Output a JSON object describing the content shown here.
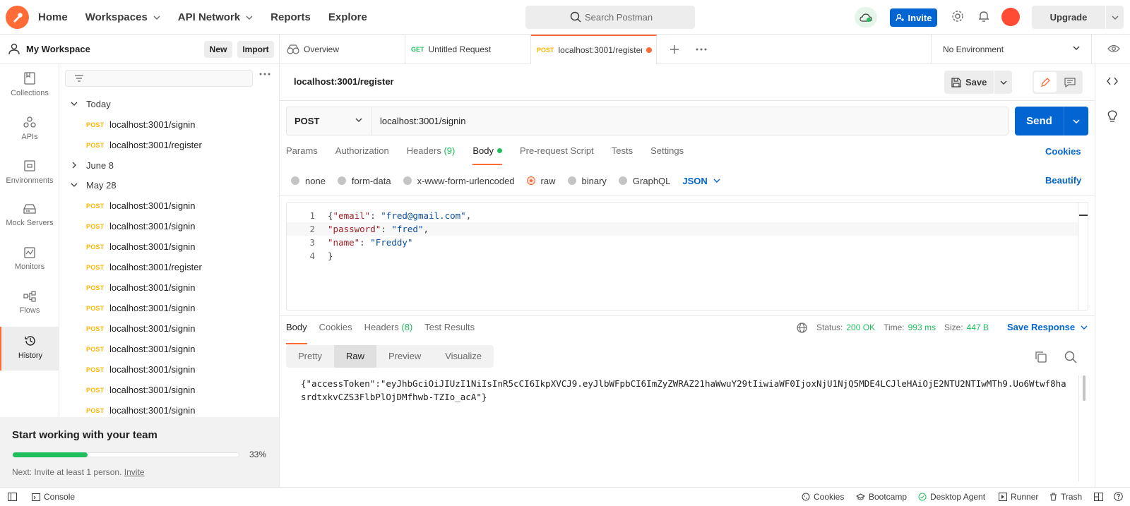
{
  "topbar": {
    "nav": [
      "Home",
      "Workspaces",
      "API Network",
      "Reports",
      "Explore"
    ],
    "search_placeholder": "Search Postman",
    "invite_label": "Invite",
    "upgrade_label": "Upgrade"
  },
  "sidebar": {
    "workspace_title": "My Workspace",
    "new_label": "New",
    "import_label": "Import",
    "rail": [
      {
        "label": "Collections",
        "icon": "collections-icon"
      },
      {
        "label": "APIs",
        "icon": "apis-icon"
      },
      {
        "label": "Environments",
        "icon": "environments-icon"
      },
      {
        "label": "Mock Servers",
        "icon": "mock-servers-icon"
      },
      {
        "label": "Monitors",
        "icon": "monitors-icon"
      },
      {
        "label": "Flows",
        "icon": "flows-icon"
      },
      {
        "label": "History",
        "icon": "history-icon",
        "active": true
      }
    ],
    "history": {
      "groups": [
        {
          "label": "Today",
          "expanded": true
        },
        {
          "label": "June 8",
          "expanded": false
        },
        {
          "label": "May 28",
          "expanded": true
        }
      ],
      "today_items": [
        {
          "method": "POST",
          "url": "localhost:3001/signin"
        },
        {
          "method": "POST",
          "url": "localhost:3001/register"
        }
      ],
      "may28_items": [
        {
          "method": "POST",
          "url": "localhost:3001/signin"
        },
        {
          "method": "POST",
          "url": "localhost:3001/signin"
        },
        {
          "method": "POST",
          "url": "localhost:3001/signin"
        },
        {
          "method": "POST",
          "url": "localhost:3001/register"
        },
        {
          "method": "POST",
          "url": "localhost:3001/signin"
        },
        {
          "method": "POST",
          "url": "localhost:3001/signin"
        },
        {
          "method": "POST",
          "url": "localhost:3001/signin"
        },
        {
          "method": "POST",
          "url": "localhost:3001/signin"
        },
        {
          "method": "POST",
          "url": "localhost:3001/signin"
        },
        {
          "method": "POST",
          "url": "localhost:3001/signin"
        },
        {
          "method": "POST",
          "url": "localhost:3001/signin"
        }
      ]
    },
    "team": {
      "heading": "Start working with your team",
      "progress": 0.33,
      "progress_label": "33%",
      "next_text": "Next: Invite at least 1 person.",
      "next_link": "Invite"
    }
  },
  "tabs": [
    {
      "label": "Overview",
      "method": ""
    },
    {
      "label": "Untitled Request",
      "method": "GET"
    },
    {
      "label": "localhost:3001/register",
      "method": "POST",
      "active": true,
      "unsaved": true
    }
  ],
  "environment": "No Environment",
  "request": {
    "title": "localhost:3001/register",
    "save_label": "Save",
    "method": "POST",
    "url": "localhost:3001/signin",
    "send_label": "Send",
    "tabs": {
      "params": "Params",
      "authorization": "Authorization",
      "headers": "Headers",
      "headers_count": "(9)",
      "body": "Body",
      "prerequest": "Pre-request Script",
      "tests": "Tests",
      "settings": "Settings"
    },
    "cookies_label": "Cookies",
    "body_types": [
      "none",
      "form-data",
      "x-www-form-urlencoded",
      "raw",
      "binary",
      "GraphQL"
    ],
    "body_type_selected": "raw",
    "format": "JSON",
    "beautify_label": "Beautify",
    "body_lines": [
      {
        "n": "1",
        "key": "\"email\"",
        "val": "\"fred@gmail.com\"",
        "open": "{",
        "end": ","
      },
      {
        "n": "2",
        "key": "\"password\"",
        "val": "\"fred\"",
        "open": "",
        "end": ","
      },
      {
        "n": "3",
        "key": "\"name\"",
        "val": "\"Freddy\"",
        "open": "",
        "end": ""
      },
      {
        "n": "4",
        "key": "",
        "val": "",
        "open": "}",
        "end": ""
      }
    ]
  },
  "response": {
    "tabs": {
      "body": "Body",
      "cookies": "Cookies",
      "headers": "Headers",
      "headers_count": "(8)",
      "tests": "Test Results"
    },
    "status_label": "Status:",
    "status": "200 OK",
    "time_label": "Time:",
    "time": "993 ms",
    "size_label": "Size:",
    "size": "447 B",
    "save_response": "Save Response",
    "formats": [
      "Pretty",
      "Raw",
      "Preview",
      "Visualize"
    ],
    "format_selected": "Raw",
    "raw_body": "{\"accessToken\":\"eyJhbGciOiJIUzI1NiIsInR5cCI6IkpXVCJ9.eyJlbWFpbCI6ImZyZWRAZ21haWwuY29tIiwiaWF0IjoxNjU1NjQ5MDE4LCJleHAiOjE2NTU2NTIwMTh9.Uo6Wtwf8hasrdtxkvCZS3FlbPlOjDMfhwb-TZIo_acA\"}"
  },
  "footer": {
    "console": "Console",
    "cookies": "Cookies",
    "bootcamp": "Bootcamp",
    "agent": "Desktop Agent",
    "runner": "Runner",
    "trash": "Trash"
  },
  "colors": {
    "accent": "#ff6c37",
    "primary": "#0265d2",
    "success": "#1ebe5d",
    "method_post": "#ffb400",
    "method_get": "#1ebe5d"
  }
}
